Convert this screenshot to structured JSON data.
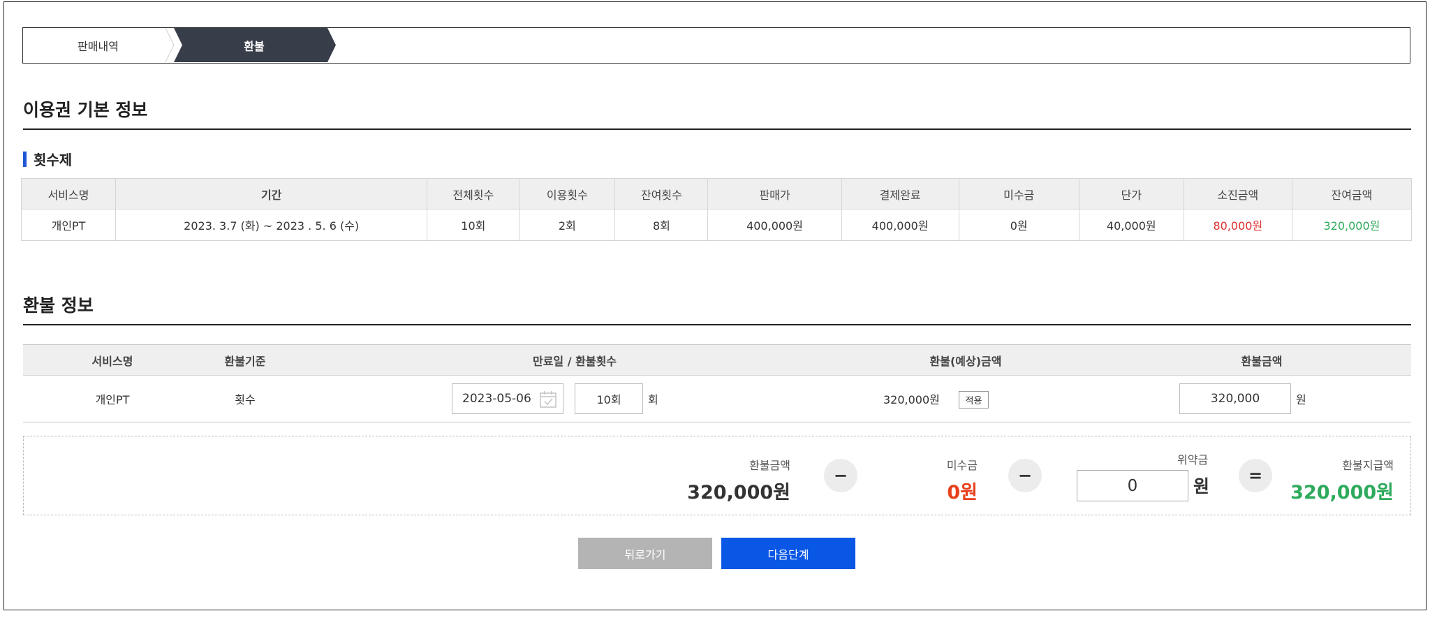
{
  "colors": {
    "step_active_bg": "#383d4a",
    "accent_blue": "#1f56d6",
    "red": "#e03131",
    "green": "#2eaa5c",
    "next_button": "#0a57e6",
    "back_button": "#b4b4b4"
  },
  "steps": [
    {
      "label": "판매내역",
      "active": false
    },
    {
      "label": "환불",
      "active": true
    }
  ],
  "ticket_section": {
    "title": "이용권 기본 정보",
    "subtitle": "횟수제",
    "headers": [
      "서비스명",
      "기간",
      "전체횟수",
      "이용횟수",
      "잔여횟수",
      "판매가",
      "결제완료",
      "미수금",
      "단가",
      "소진금액",
      "잔여금액"
    ],
    "row": {
      "service": "개인PT",
      "period": "2023. 3.7 (화) ~ 2023 . 5. 6 (수)",
      "total_count": "10회",
      "used_count": "2회",
      "remaining_count": "8회",
      "sale_price": "400,000원",
      "paid": "400,000원",
      "unpaid": "0원",
      "unit_price": "40,000원",
      "consumed_amount": "80,000원",
      "remaining_amount": "320,000원"
    }
  },
  "refund_section": {
    "title": "환불 정보",
    "headers": {
      "service": "서비스명",
      "basis": "환불기준",
      "expiry": "만료일 / 환불횟수",
      "estimated": "환불(예상)금액",
      "amount": "환불금액"
    },
    "row": {
      "service": "개인PT",
      "basis": "횟수",
      "expiry_date": "2023-05-06",
      "refund_count": "10회",
      "count_unit": "회",
      "estimated_amount": "320,000원",
      "apply_label": "적용",
      "refund_amount": "320,000",
      "amount_unit": "원"
    }
  },
  "summary": {
    "refund_label": "환불금액",
    "refund_value": "320,000원",
    "minus_symbol": "−",
    "unpaid_label": "미수금",
    "unpaid_value": "0원",
    "penalty_label": "위약금",
    "penalty_value": "0",
    "penalty_unit": "원",
    "equals_symbol": "=",
    "payout_label": "환불지급액",
    "payout_value": "320,000원"
  },
  "buttons": {
    "back": "뒤로가기",
    "next": "다음단계"
  }
}
